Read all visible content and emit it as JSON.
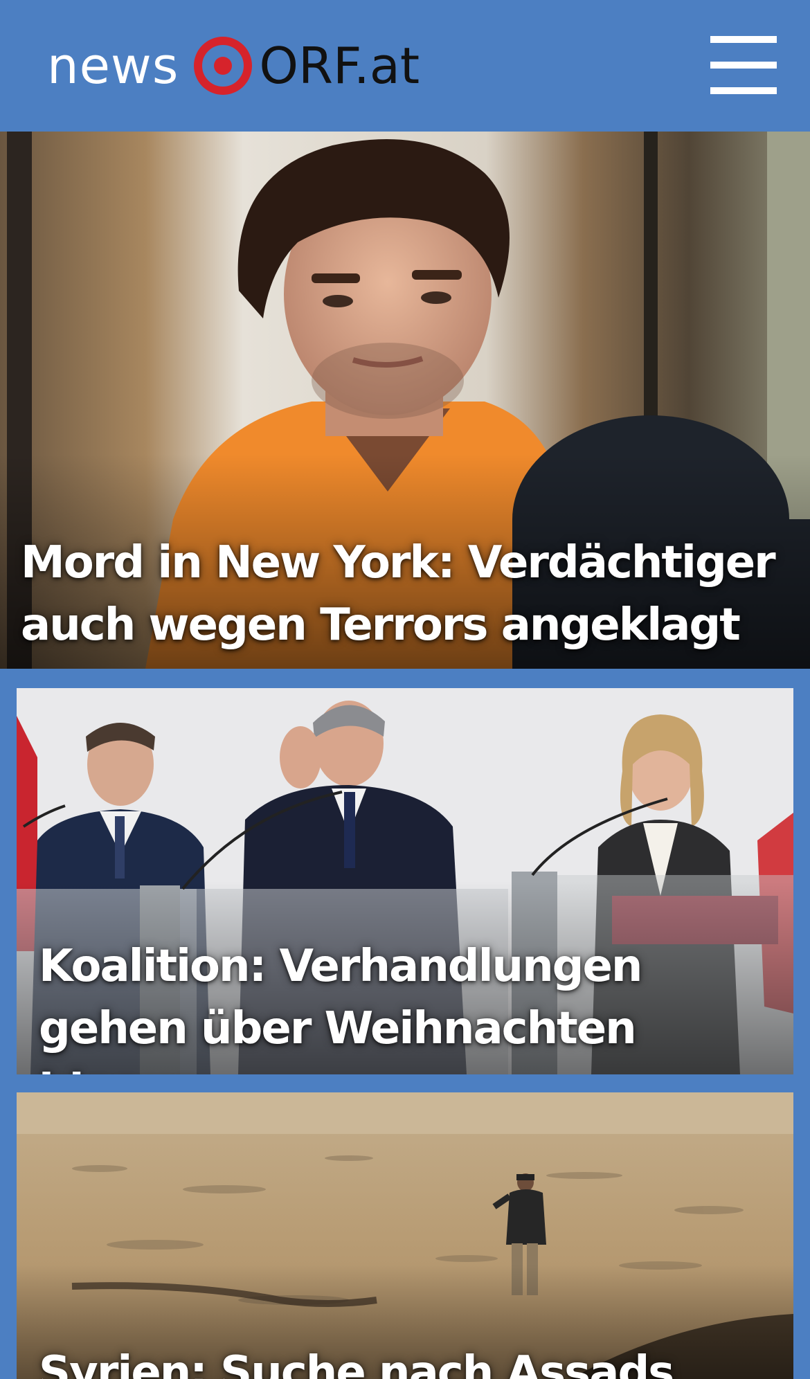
{
  "header": {
    "logo_news": "news",
    "logo_orf": "ORF.at",
    "menu_icon": "hamburger-menu-icon",
    "background_color": "#4c7fc2",
    "logo_accent_color": "#d6232b"
  },
  "stories": [
    {
      "headline": "Mord in New York: Verdächtiger auch wegen Terrors angeklagt",
      "image": "photo of young man with curly hair in orange prison jumpsuit in courtroom"
    },
    {
      "headline": "Koalition: Verhandlungen gehen über Weihnachten hinaus",
      "image": "photo of three politicians at glass lecterns at a press conference"
    },
    {
      "headline": "Syrien: Suche nach Assads",
      "image": "photo of a man standing alone in a barren, dusty field"
    }
  ]
}
